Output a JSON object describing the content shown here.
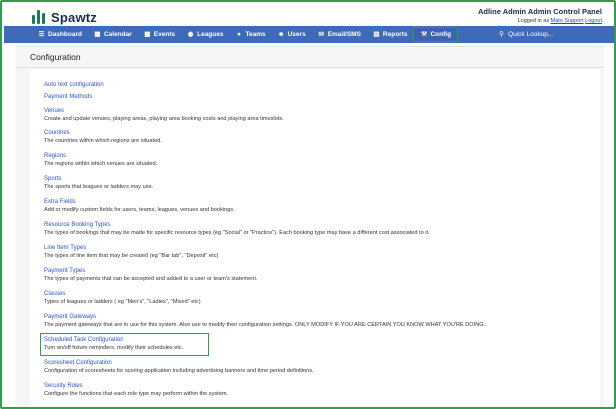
{
  "header": {
    "brand": "Spawtz",
    "admin_title": "Adline Admin Admin Control Panel",
    "logged_in_prefix": "Logged in as ",
    "logged_in_user": "Mato Support",
    "logout_label": "Logout"
  },
  "navbar": {
    "items": [
      {
        "icon": "layers-icon",
        "label": "Dashboard"
      },
      {
        "icon": "calendar-icon",
        "label": "Calendar"
      },
      {
        "icon": "events-icon",
        "label": "Events"
      },
      {
        "icon": "leagues-icon",
        "label": "Leagues"
      },
      {
        "icon": "teams-icon",
        "label": "Teams"
      },
      {
        "icon": "user-icon",
        "label": "Users"
      },
      {
        "icon": "email-icon",
        "label": "Email/SMS"
      },
      {
        "icon": "reports-icon",
        "label": "Reports"
      },
      {
        "icon": "wrench-icon",
        "label": "Config"
      }
    ],
    "active": "Config",
    "quick_lookup": "Quick Lookup..."
  },
  "page": {
    "title": "Configuration"
  },
  "config_items": [
    {
      "title": "Auto text configuration",
      "desc": ""
    },
    {
      "title": "Payment Methods",
      "desc": ""
    },
    {
      "title": "Venues",
      "desc": "Create and update venues, playing areas, playing area booking costs and playing area timeslots."
    },
    {
      "title": "Countries",
      "desc": "The countries within which regions are situated."
    },
    {
      "title": "Regions",
      "desc": "The regions within which venues are situated."
    },
    {
      "title": "Sports",
      "desc": "The sports that leagues or ladders may use."
    },
    {
      "title": "Extra Fields",
      "desc": "Add or modify custom fields for users, teams, leagues, venues and bookings."
    },
    {
      "title": "Resource Booking Types",
      "desc": "The types of bookings that may be made for specific resource types (eg \"Social\" or \"Practice\"). Each booking type may have a different cost associated to it."
    },
    {
      "title": "Line Item Types",
      "desc": "The types of line item that may be created (eg \"Bar tab\", \"Deposit\" etc)"
    },
    {
      "title": "Payment Types",
      "desc": "The types of payments that can be accepted and added to a user or team's statement."
    },
    {
      "title": "Classes",
      "desc": "Types of leagues or ladders ( eg \"Men's\", \"Ladies\", \"Mixed\" etc)"
    },
    {
      "title": "Payment Gateways",
      "desc": "The payment gateways that are in use for this system. Also use to modify their configuration settings. ONLY MODIFY IF YOU ARE CERTAIN YOU KNOW WHAT YOU'RE DOING."
    },
    {
      "title": "Scheduled Task Configuration",
      "desc": "Turn on/off fixture reminders, modify their schedules etc."
    },
    {
      "title": "Scoresheet Configuration",
      "desc": "Configuration of scoresheets for scoring application including advertising banners and time period definitions."
    },
    {
      "title": "Security Roles",
      "desc": "Configure the functions that each role type may perform within the system."
    }
  ]
}
